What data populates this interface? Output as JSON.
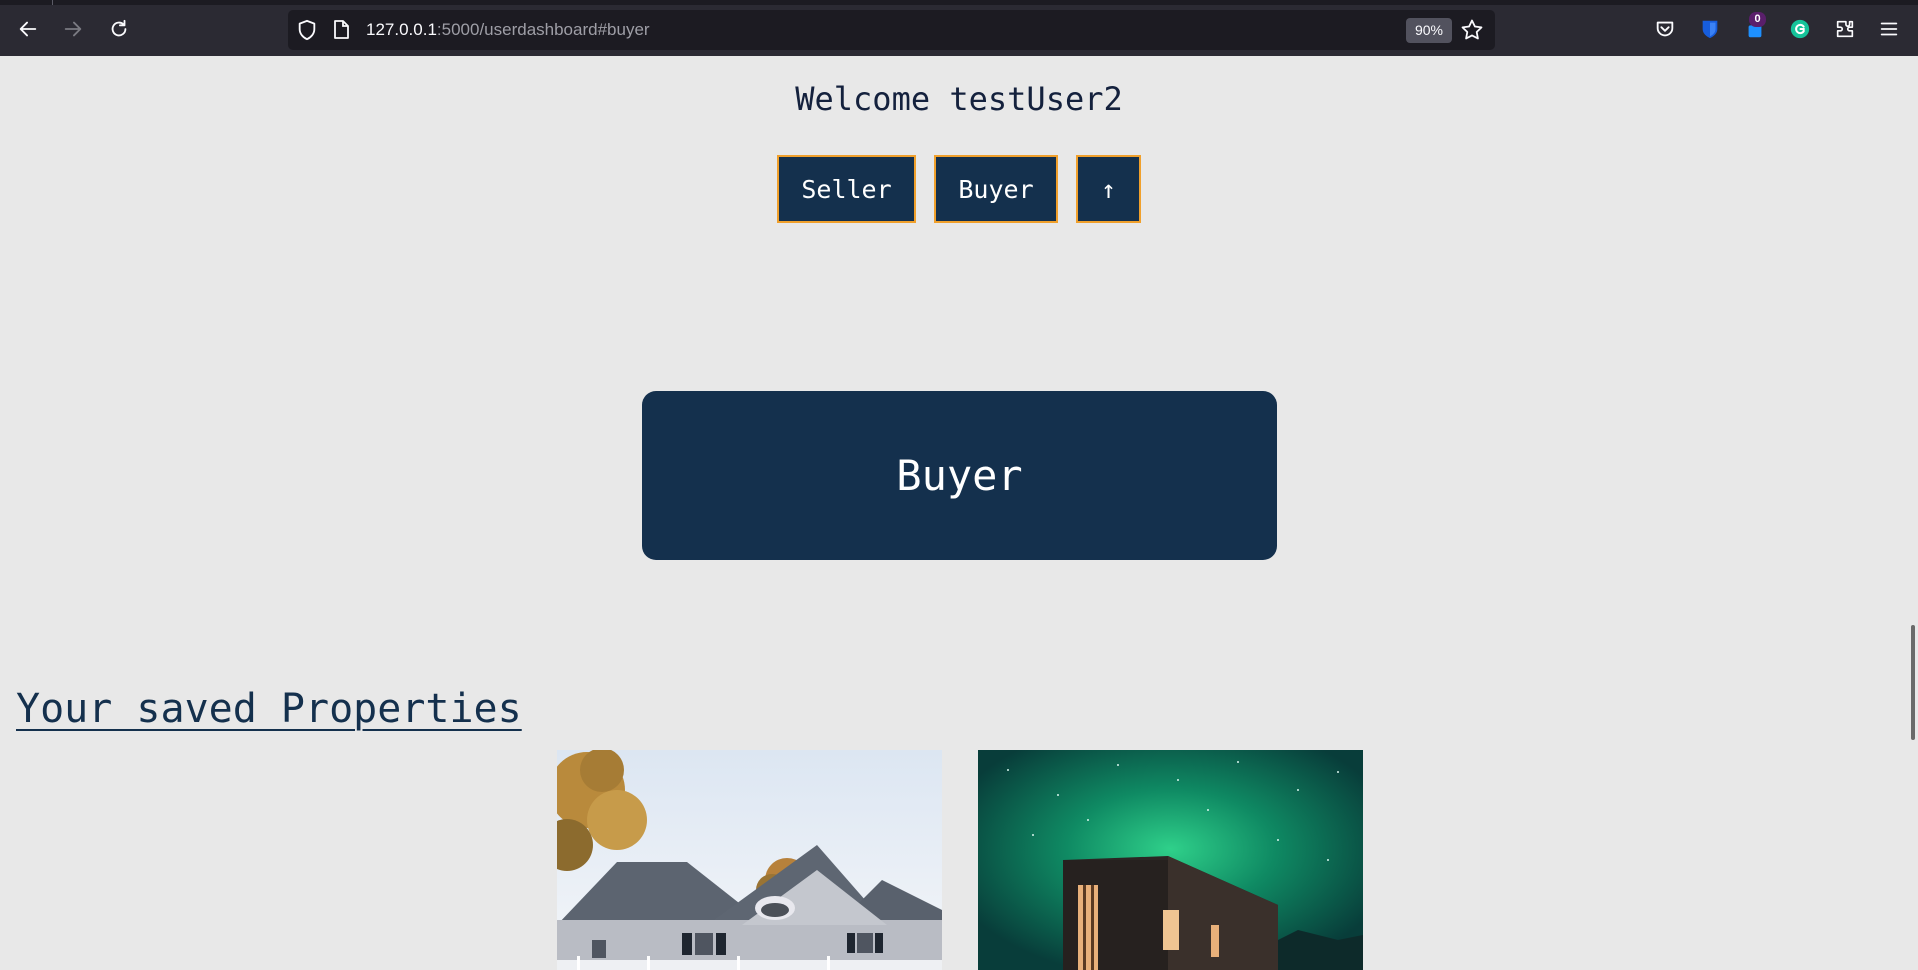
{
  "browser": {
    "url_host": "127.0.0.1",
    "url_rest": ":5000/userdashboard#buyer",
    "zoom": "90%",
    "extension_badge": "0",
    "icons": [
      "back-icon",
      "forward-icon",
      "reload-icon",
      "shield-icon",
      "page-icon",
      "bookmark-star-icon",
      "pocket-icon",
      "bitwarden-icon",
      "extension-badge-icon",
      "grammarly-icon",
      "extensions-icon",
      "menu-icon"
    ]
  },
  "page": {
    "welcome": "Welcome testUser2",
    "nav_buttons": {
      "seller": "Seller",
      "buyer": "Buyer",
      "up": "↑"
    },
    "panel_title": "Buyer",
    "saved_heading": "Your saved Properties",
    "properties": [
      {
        "image": "white-house-photo"
      },
      {
        "image": "cabin-aurora-photo"
      }
    ]
  },
  "colors": {
    "background": "#e8e8e8",
    "navy": "#14304d",
    "accent_border": "#f0a02c",
    "heading_text": "#14213d"
  }
}
